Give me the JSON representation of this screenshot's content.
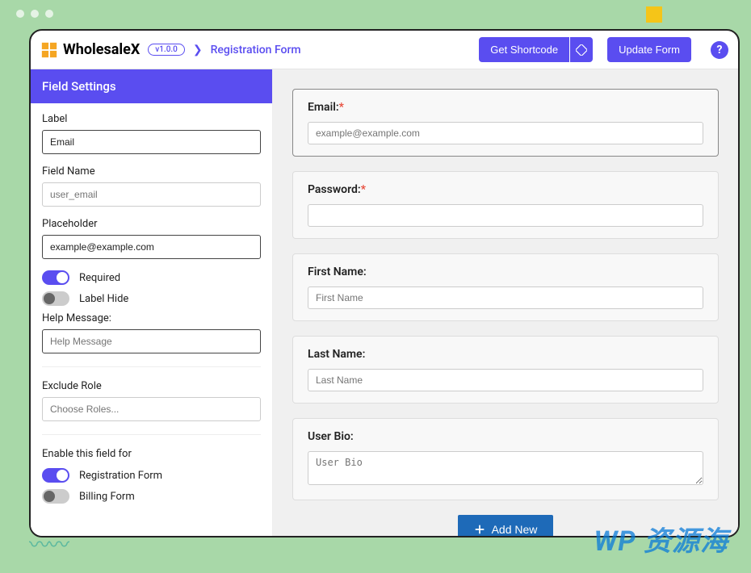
{
  "brand": {
    "name": "WholesaleX",
    "version": "v1.0.0"
  },
  "breadcrumb": {
    "page": "Registration Form"
  },
  "topbar": {
    "get_shortcode": "Get Shortcode",
    "update_form": "Update Form",
    "help": "?"
  },
  "sidebar": {
    "title": "Field Settings",
    "label": {
      "title": "Label",
      "value": "Email"
    },
    "field_name": {
      "title": "Field Name",
      "placeholder": "user_email"
    },
    "placeholder": {
      "title": "Placeholder",
      "value": "example@example.com"
    },
    "required": {
      "label": "Required",
      "on": true
    },
    "label_hide": {
      "label": "Label Hide",
      "on": false
    },
    "help_message": {
      "title": "Help Message:",
      "placeholder": "Help Message"
    },
    "exclude_role": {
      "title": "Exclude Role",
      "placeholder": "Choose Roles..."
    },
    "enable_for": {
      "title": "Enable this field for",
      "registration": {
        "label": "Registration Form",
        "on": true
      },
      "billing": {
        "label": "Billing Form",
        "on": false
      }
    }
  },
  "form": {
    "email": {
      "label": "Email:",
      "required": true,
      "placeholder": "example@example.com"
    },
    "password": {
      "label": "Password:",
      "required": true,
      "placeholder": ""
    },
    "first_name": {
      "label": "First Name:",
      "required": false,
      "placeholder": "First Name"
    },
    "last_name": {
      "label": "Last Name:",
      "required": false,
      "placeholder": "Last Name"
    },
    "user_bio": {
      "label": "User Bio:",
      "required": false,
      "placeholder": "User Bio"
    },
    "add_new": "Add New"
  },
  "watermark": "WP 资源海"
}
